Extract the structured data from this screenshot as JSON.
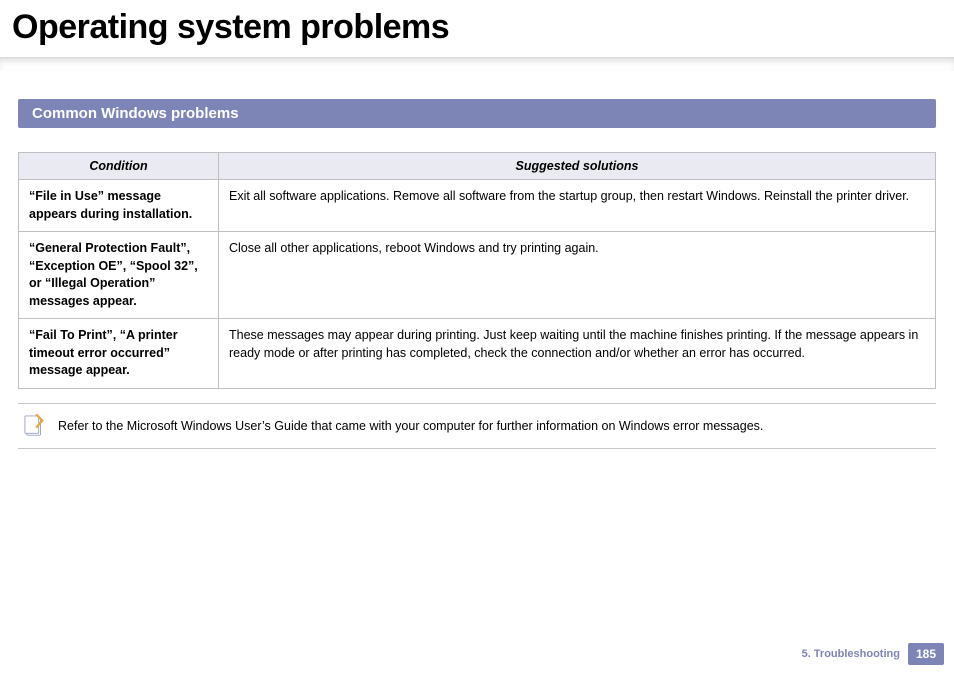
{
  "title": "Operating system problems",
  "section_heading": "Common Windows problems",
  "table": {
    "headers": {
      "condition": "Condition",
      "solutions": "Suggested solutions"
    },
    "rows": [
      {
        "condition": "“File in Use” message appears during installation.",
        "solution": "Exit all software applications. Remove all software from the startup group, then restart Windows. Reinstall the printer driver."
      },
      {
        "condition": "“General Protection Fault”, “Exception OE”, “Spool 32”, or “Illegal Operation” messages appear.",
        "solution": "Close all other applications, reboot Windows and try printing again."
      },
      {
        "condition": "“Fail To Print”, “A printer timeout error occurred” message appear.",
        "solution": "These messages may appear during printing. Just keep waiting until the machine finishes printing. If the message appears in ready mode or after printing has completed, check the connection and/or whether an error has occurred."
      }
    ]
  },
  "note": "Refer to the Microsoft Windows User’s Guide that came with your computer for further information on Windows error messages.",
  "footer": {
    "chapter": "5.  Troubleshooting",
    "page": "185"
  }
}
